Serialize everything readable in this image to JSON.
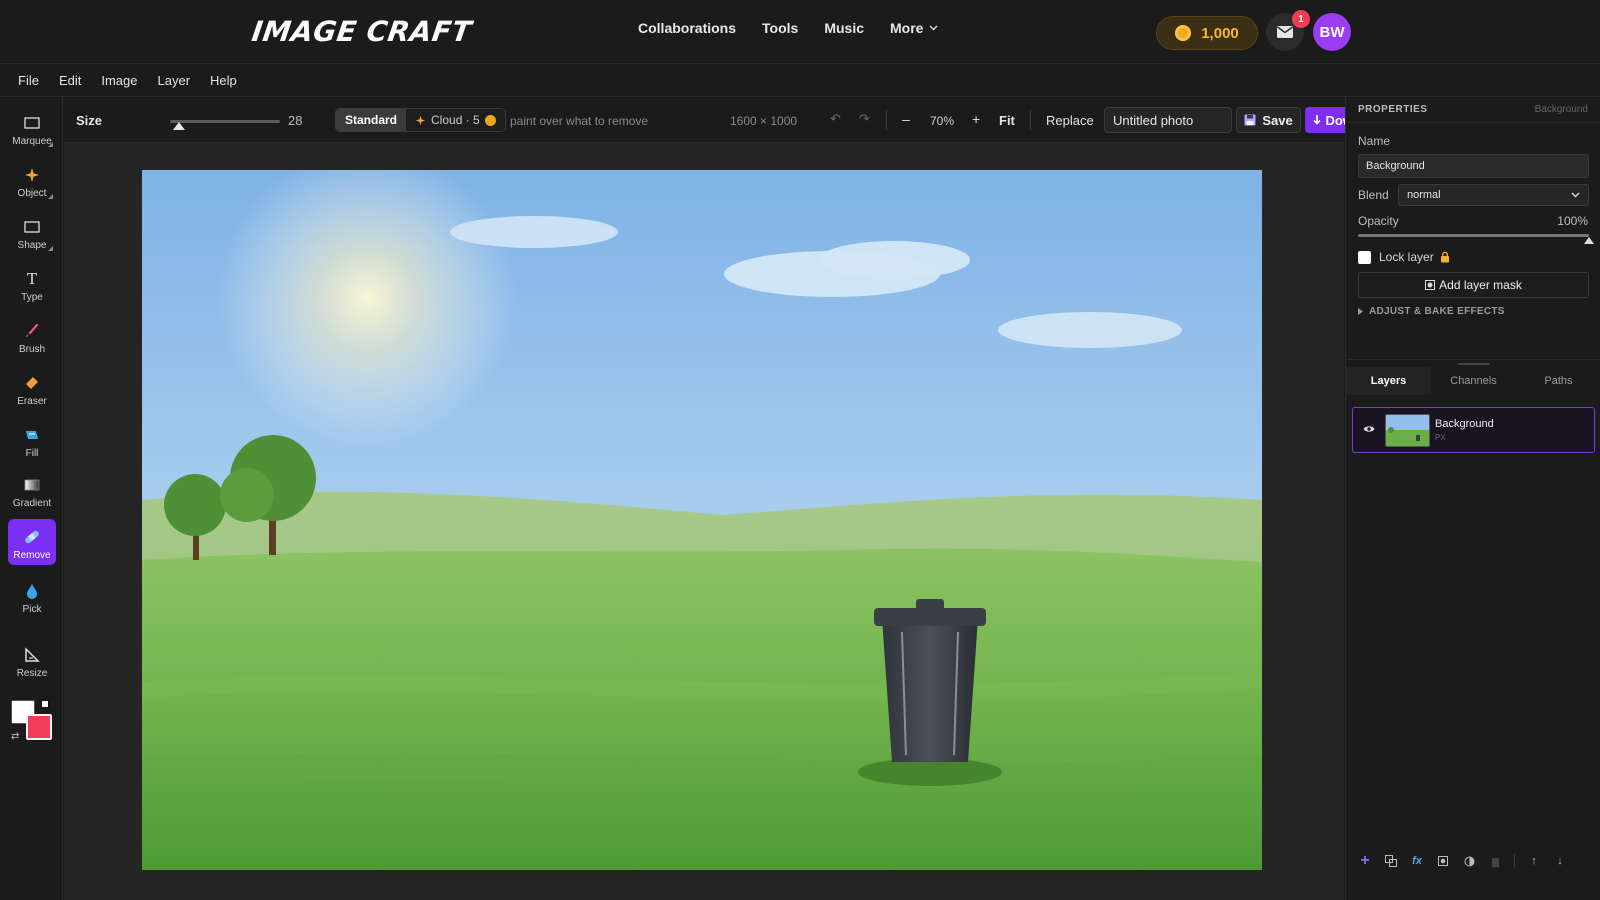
{
  "app": {
    "logo": "IMAGE CRAFT",
    "nav": [
      "Collaborations",
      "Tools",
      "Music",
      "More"
    ],
    "coins": "1,000",
    "inbox_badge": "1",
    "avatar_initials": "BW"
  },
  "menubar": [
    "File",
    "Edit",
    "Image",
    "Layer",
    "Help"
  ],
  "tools": [
    {
      "label": "Marquee",
      "icon": "marquee-icon"
    },
    {
      "label": "Object",
      "icon": "sparkle-icon"
    },
    {
      "label": "Shape",
      "icon": "rectangle-icon"
    },
    {
      "label": "Type",
      "icon": "type-icon"
    },
    {
      "label": "Brush",
      "icon": "brush-icon"
    },
    {
      "label": "Eraser",
      "icon": "eraser-icon"
    },
    {
      "label": "Fill",
      "icon": "fill-icon"
    },
    {
      "label": "Gradient",
      "icon": "gradient-icon"
    },
    {
      "label": "Remove",
      "icon": "bandage-icon",
      "active": true
    },
    {
      "label": "Pick",
      "icon": "droplet-icon"
    },
    {
      "label": "Resize",
      "icon": "resize-icon"
    }
  ],
  "colors": {
    "foreground": "#ffffff",
    "background": "#f23d5a",
    "accent": "#7d2ef2"
  },
  "options": {
    "size_label": "Size",
    "size_value": "28",
    "mode_standard": "Standard",
    "mode_cloud": "Cloud · 5",
    "hint": "paint over what to remove",
    "dimensions": "1600 × 1000",
    "zoom": "70%",
    "fit": "Fit",
    "replace": "Replace",
    "document_name": "Untitled photo",
    "save": "Save",
    "download": "Download"
  },
  "properties": {
    "header": "PROPERTIES",
    "header_sub": "Background",
    "name_label": "Name",
    "name_value": "Background",
    "blend_label": "Blend",
    "blend_value": "normal",
    "opacity_label": "Opacity",
    "opacity_value": "100%",
    "lock_label": "Lock layer",
    "add_mask": "Add layer mask",
    "adjust": "ADJUST & BAKE EFFECTS"
  },
  "layers_panel": {
    "tabs": [
      "Layers",
      "Channels",
      "Paths"
    ],
    "layers": [
      {
        "name": "Background",
        "type": "PX"
      }
    ]
  }
}
